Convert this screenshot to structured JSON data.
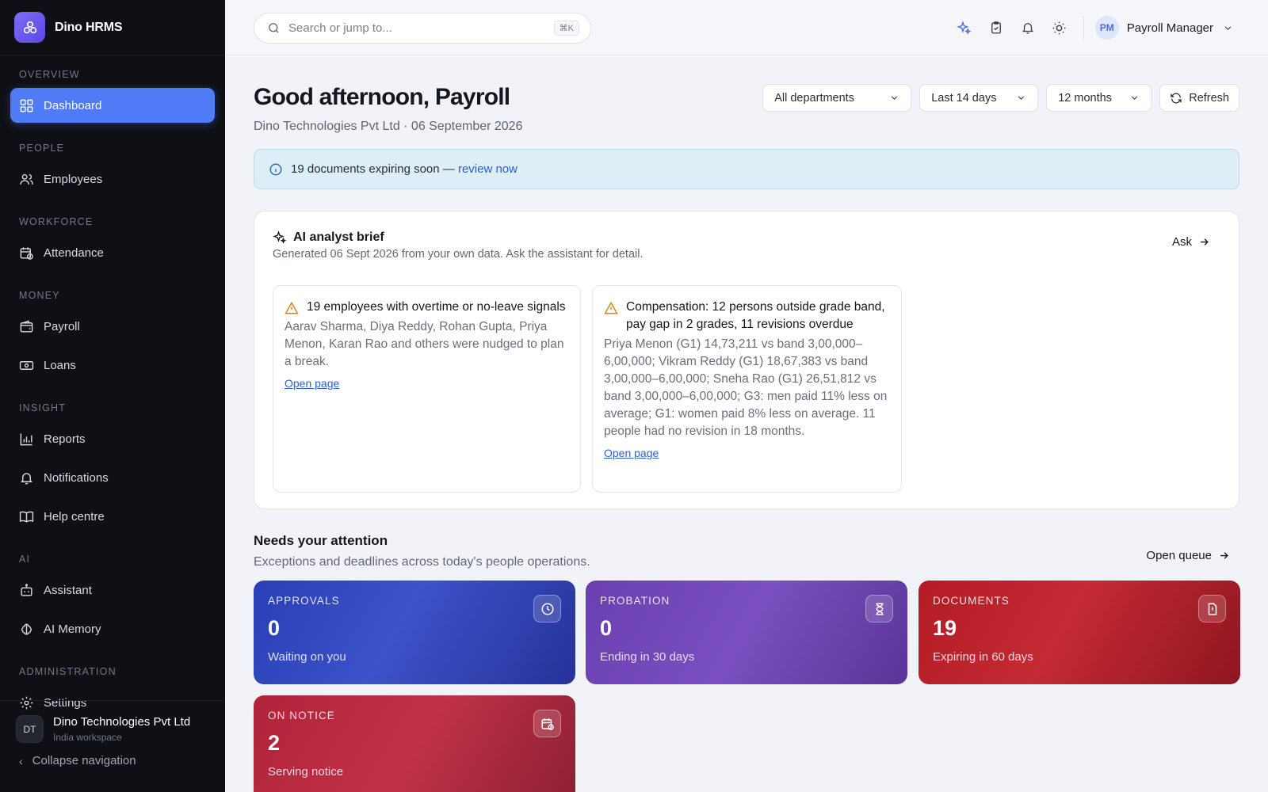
{
  "app": {
    "name": "Dino HRMS"
  },
  "sidebar": {
    "sections": [
      {
        "title": "OVERVIEW",
        "items": [
          {
            "label": "Dashboard",
            "icon": "dashboard-icon",
            "active": true
          }
        ]
      },
      {
        "title": "PEOPLE",
        "items": [
          {
            "label": "Employees",
            "icon": "users-icon"
          }
        ]
      },
      {
        "title": "WORKFORCE",
        "items": [
          {
            "label": "Attendance",
            "icon": "calendar-clock-icon"
          }
        ]
      },
      {
        "title": "MONEY",
        "items": [
          {
            "label": "Payroll",
            "icon": "wallet-icon"
          },
          {
            "label": "Loans",
            "icon": "banknote-icon"
          }
        ]
      },
      {
        "title": "INSIGHT",
        "items": [
          {
            "label": "Reports",
            "icon": "bar-chart-icon"
          },
          {
            "label": "Notifications",
            "icon": "bell-icon"
          },
          {
            "label": "Help centre",
            "icon": "book-icon"
          }
        ]
      },
      {
        "title": "AI",
        "items": [
          {
            "label": "Assistant",
            "icon": "bot-icon"
          },
          {
            "label": "AI Memory",
            "icon": "brain-icon"
          }
        ]
      },
      {
        "title": "ADMINISTRATION",
        "items": [
          {
            "label": "Settings",
            "icon": "gear-icon"
          }
        ]
      }
    ],
    "workspace": {
      "initials": "DT",
      "name": "Dino Technologies Pvt Ltd",
      "subtitle": "India workspace"
    },
    "collapse_label": "Collapse navigation"
  },
  "topbar": {
    "search_placeholder": "Search or jump to...",
    "search_shortcut": "⌘K",
    "user": {
      "initials": "PM",
      "name": "Payroll Manager"
    }
  },
  "header": {
    "greeting": "Good afternoon, Payroll",
    "subtitle": "Dino Technologies Pvt Ltd · 06 September 2026",
    "filters": {
      "department": "All departments",
      "period": "Last 14 days",
      "range": "12 months"
    },
    "refresh_label": "Refresh"
  },
  "banner": {
    "text": "19 documents expiring soon — ",
    "link": "review now"
  },
  "ai_brief": {
    "title": "AI analyst brief",
    "subtitle": "Generated 06 Sept 2026 from your own data. Ask the assistant for detail.",
    "ask_label": "Ask",
    "insights": [
      {
        "title": "19 employees with overtime or no-leave signals",
        "body": "Aarav Sharma, Diya Reddy, Rohan Gupta, Priya Menon, Karan Rao and others were nudged to plan a break.",
        "link": "Open page"
      },
      {
        "title": "Compensation: 12 persons outside grade band, pay gap in 2 grades, 11 revisions overdue",
        "body": "Priya Menon (G1) 14,73,211 vs band 3,00,000–6,00,000; Vikram Reddy (G1) 18,67,383 vs band 3,00,000–6,00,000; Sneha Rao (G1) 26,51,812 vs band 3,00,000–6,00,000; G3: men paid 11% less on average; G1: women paid 8% less on average. 11 people had no revision in 18 months.",
        "link": "Open page"
      }
    ]
  },
  "attention": {
    "title": "Needs your attention",
    "subtitle": "Exceptions and deadlines across today's people operations.",
    "open_queue_label": "Open queue",
    "tiles": [
      {
        "label": "APPROVALS",
        "value": "0",
        "desc": "Waiting on you",
        "icon": "clock-icon",
        "color": "#2a3fb6"
      },
      {
        "label": "PROBATION",
        "value": "0",
        "desc": "Ending in 30 days",
        "icon": "hourglass-icon",
        "color": "#6a3fb0"
      },
      {
        "label": "DOCUMENTS",
        "value": "19",
        "desc": "Expiring in 60 days",
        "icon": "file-alert-icon",
        "color": "#b51b25"
      },
      {
        "label": "ON NOTICE",
        "value": "2",
        "desc": "Serving notice",
        "icon": "calendar-clock-icon",
        "color": "#b0233a"
      }
    ]
  }
}
